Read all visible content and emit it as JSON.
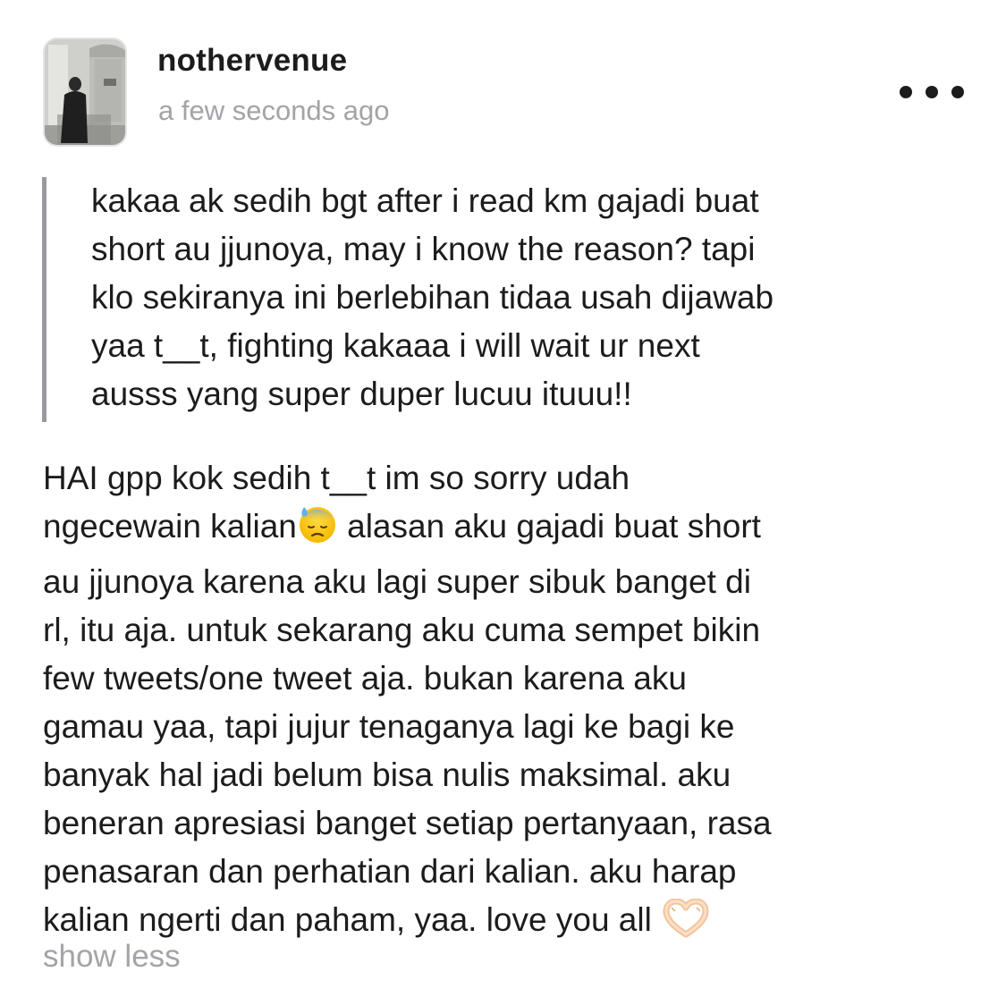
{
  "post": {
    "username": "nothervenue",
    "timestamp": "a few seconds ago",
    "avatar_icon": "profile-photo",
    "more_icon": "more-horizontal-icon"
  },
  "question": {
    "lines": [
      "kakaa ak sedih bgt after i read km gajadi buat",
      "short au jjunoya, may i know the reason? tapi",
      "klo sekiranya ini berlebihan tidaa usah dijawab",
      "yaa t__t, fighting kakaaa i will wait ur next",
      "ausss yang super duper lucuu ituuu!!"
    ]
  },
  "answer": {
    "line1": "HAI gpp kok sedih t__t im so sorry udah",
    "line2_a": "ngecewain kalian",
    "line2_emoji": "downcast-sweat-emoji",
    "line2_b": " alasan aku gajadi buat short",
    "lines_mid": [
      "au jjunoya karena aku lagi super sibuk banget di",
      "rl, itu aja. untuk sekarang aku cuma sempet bikin",
      "few tweets/one tweet aja. bukan karena aku",
      "gamau yaa, tapi jujur tenaganya lagi ke bagi ke",
      "banyak hal jadi belum bisa nulis maksimal. aku",
      "beneran apresiasi banget setiap pertanyaan, rasa",
      "penasaran dan perhatian dari kalian. aku harap"
    ],
    "last_line": "kalian ngerti dan paham, yaa. love you all",
    "last_emoji": "heart-hands-emoji"
  },
  "show_less_label": "show less",
  "colors": {
    "text": "#1c1c1e",
    "muted": "#a3a3a8",
    "quote_bar": "#9a9a9e"
  }
}
